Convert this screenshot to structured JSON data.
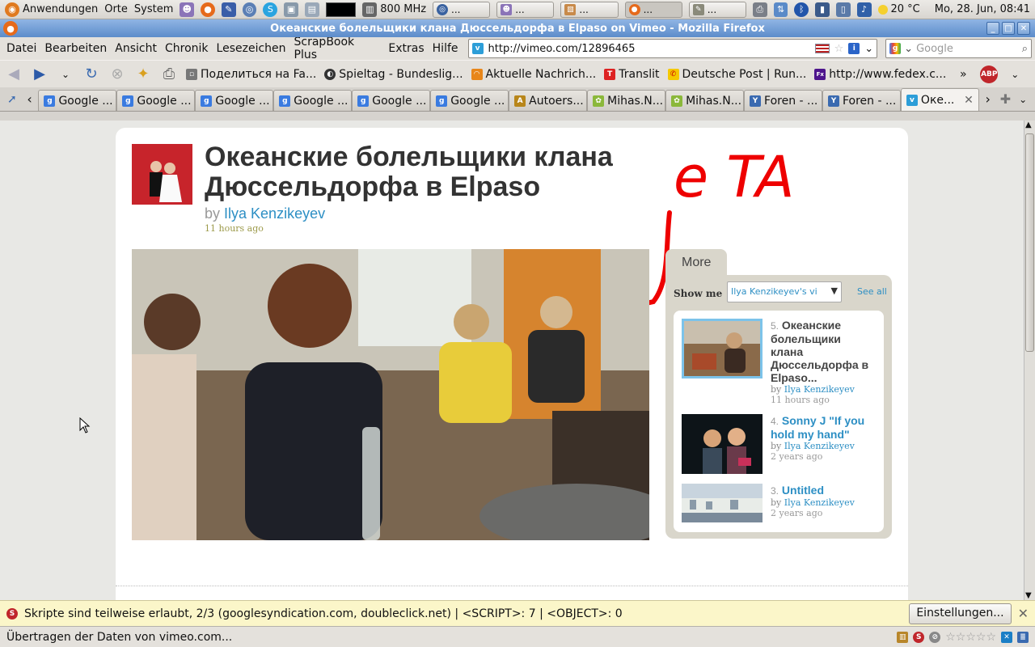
{
  "panel": {
    "applications": "Anwendungen",
    "places": "Orte",
    "system": "System",
    "cpu_freq": "800 MHz",
    "temperature": "20 °C",
    "clock": "Mo, 28. Jun, 08:41",
    "tasks": [
      "...",
      "...",
      "...",
      "...",
      "..."
    ]
  },
  "window": {
    "title": "Океанские болельщики клана Дюссельдорфа в Elpaso on Vimeo - Mozilla Firefox"
  },
  "menubar": {
    "items": [
      "Datei",
      "Bearbeiten",
      "Ansicht",
      "Chronik",
      "Lesezeichen",
      "ScrapBook Plus",
      "Extras",
      "Hilfe"
    ],
    "url": "http://vimeo.com/12896465",
    "search_placeholder": "Google"
  },
  "bookmarks": [
    "Поделиться на Fa...",
    "Spieltag - Bundeslig...",
    "Aktuelle Nachrich...",
    "Translit",
    "Deutsche Post | Run...",
    "http://www.fedex.c..."
  ],
  "tabs": [
    "Google ...",
    "Google ...",
    "Google ...",
    "Google ...",
    "Google ...",
    "Google ...",
    "Autoers...",
    "Mihas.N...",
    "Mihas.N...",
    "Foren - ...",
    "Foren - ...",
    "Оке..."
  ],
  "page": {
    "title": "Океанские болельщики клана Дюссельдорфа в Elpaso",
    "by": "by",
    "author": "Ilya Kenzikeyev",
    "ago": "11 hours ago",
    "annotation": "e TA",
    "more_tab": "More",
    "show_me": "Show me",
    "show_select": "Ilya Kenzikeyev's vi",
    "see_all": "See all",
    "videos": [
      {
        "num": "5.",
        "title": "Океанские болельщики клана Дюссельдорфа в Elpaso...",
        "by": "by",
        "author": "Ilya Kenzikeyev",
        "ago": "11 hours ago"
      },
      {
        "num": "4.",
        "title": "Sonny J \"If you hold my hand\"",
        "by": "by",
        "author": "Ilya Kenzikeyev",
        "ago": "2 years ago"
      },
      {
        "num": "3.",
        "title": "Untitled",
        "by": "by",
        "author": "Ilya Kenzikeyev",
        "ago": "2 years ago"
      }
    ]
  },
  "notification": {
    "text": "Skripte sind teilweise erlaubt, 2/3 (googlesyndication.com, doubleclick.net) | <SCRIPT>: 7 | <OBJECT>: 0",
    "button": "Einstellungen..."
  },
  "status": {
    "text": "Übertragen der Daten von vimeo.com..."
  }
}
